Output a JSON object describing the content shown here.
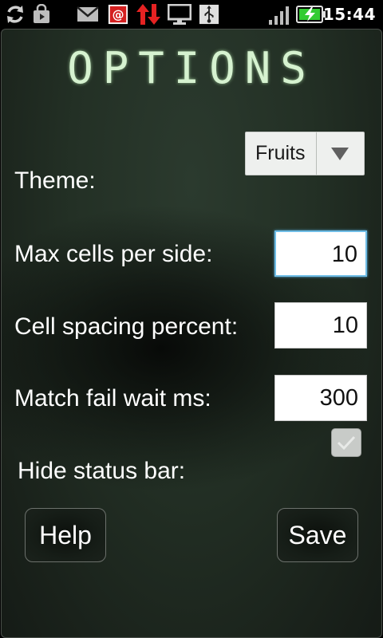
{
  "status_bar": {
    "time": "15:44",
    "icons": [
      "sync-icon",
      "shopping-bag-icon",
      "gmail-icon",
      "email-notification-icon",
      "data-transfer-icon",
      "monitor-icon",
      "usb-icon",
      "signal-icon",
      "battery-charging-icon"
    ],
    "colors": {
      "email_notification": "#d42020",
      "data_transfer": "#e52222",
      "battery": "#33cc33"
    }
  },
  "screen": {
    "title": "OPTIONS",
    "theme": {
      "label": "Theme:",
      "value": "Fruits"
    },
    "max_cells": {
      "label": "Max cells per side:",
      "value": "10"
    },
    "cell_spacing": {
      "label": "Cell spacing percent:",
      "value": "10"
    },
    "match_fail_wait": {
      "label": "Match fail wait ms:",
      "value": "300"
    },
    "hide_status_bar": {
      "label": "Hide status bar:",
      "checked": true
    },
    "buttons": {
      "help": "Help",
      "save": "Save"
    }
  }
}
